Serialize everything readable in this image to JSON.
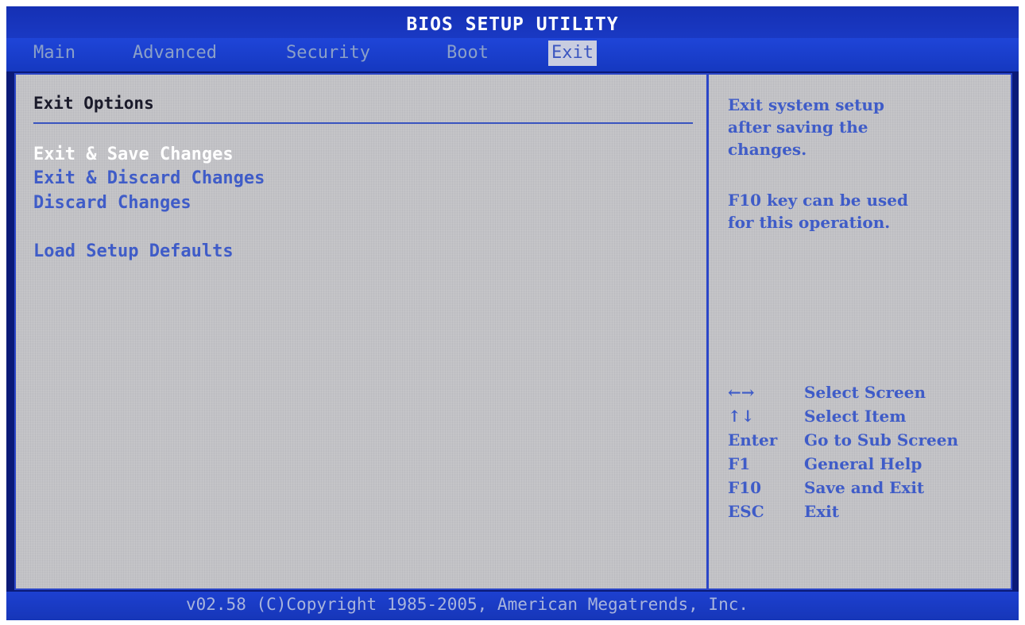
{
  "title": "BIOS SETUP UTILITY",
  "tabs": [
    {
      "label": "Main"
    },
    {
      "label": "Advanced"
    },
    {
      "label": "Security"
    },
    {
      "label": "Boot"
    },
    {
      "label": "Exit",
      "active": true
    }
  ],
  "main": {
    "section_title": "Exit Options",
    "items": [
      {
        "label": "Exit & Save Changes",
        "selected": true
      },
      {
        "label": "Exit & Discard Changes"
      },
      {
        "label": "Discard Changes"
      },
      {
        "label": "Load Setup Defaults"
      }
    ]
  },
  "help": {
    "description": [
      "Exit system setup",
      "after saving the",
      "changes.",
      "F10 key can be used",
      "for this operation."
    ],
    "keys": [
      {
        "key": "←→",
        "action": "Select Screen"
      },
      {
        "key": "↑↓",
        "action": "Select Item"
      },
      {
        "key": "Enter",
        "action": "Go to Sub Screen"
      },
      {
        "key": "F1",
        "action": "General Help"
      },
      {
        "key": "F10",
        "action": "Save and Exit"
      },
      {
        "key": "ESC",
        "action": "Exit"
      }
    ]
  },
  "footer": "v02.58 (C)Copyright 1985-2005, American Megatrends, Inc.",
  "colors": {
    "background": "#0a1a78",
    "title_bar": "#1b3cc8",
    "panel": "#c2c2c6",
    "item_text": "#3f5cc8",
    "selected_text": "#ffffff",
    "inactive_tab": "#8ba0c8"
  }
}
